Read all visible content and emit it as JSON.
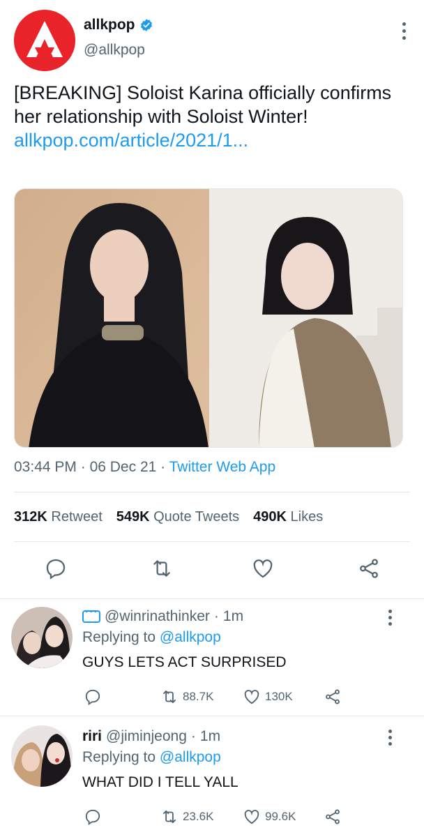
{
  "tweet": {
    "author_name": "allkpop",
    "author_handle": "@allkpop",
    "text": "[BREAKING] Soloist Karina officially confirms her relationship with Soloist Winter!",
    "link": "allkpop.com/article/2021/1...",
    "time": "03:44 PM",
    "date": "06 Dec 21",
    "separator": "·",
    "source": "Twitter Web App",
    "stats": {
      "retweets": "312K",
      "retweets_label": "Retweet",
      "quotes": "549K",
      "quotes_label": "Quote Tweets",
      "likes": "490K",
      "likes_label": "Likes"
    },
    "colors": {
      "brand_red": "#e8242a",
      "link_blue": "#1d9bf0",
      "muted": "#536471"
    }
  },
  "replies": [
    {
      "name": "",
      "handle": "@winrinathinker",
      "time": "1m",
      "replying_label": "Replying to",
      "replying_to": "@allkpop",
      "text": "GUYS LETS ACT SURPRISED",
      "retweets": "88.7K",
      "likes": "130K"
    },
    {
      "name": "riri",
      "handle": "@jiminjeong",
      "time": "1m",
      "replying_label": "Replying to",
      "replying_to": "@allkpop",
      "text": "WHAT DID I TELL YALL",
      "retweets": "23.6K",
      "likes": "99.6K"
    }
  ],
  "icons": [
    "verified-icon",
    "more-icon",
    "reply-icon",
    "retweet-icon",
    "like-icon",
    "share-icon",
    "allkpop-logo"
  ]
}
